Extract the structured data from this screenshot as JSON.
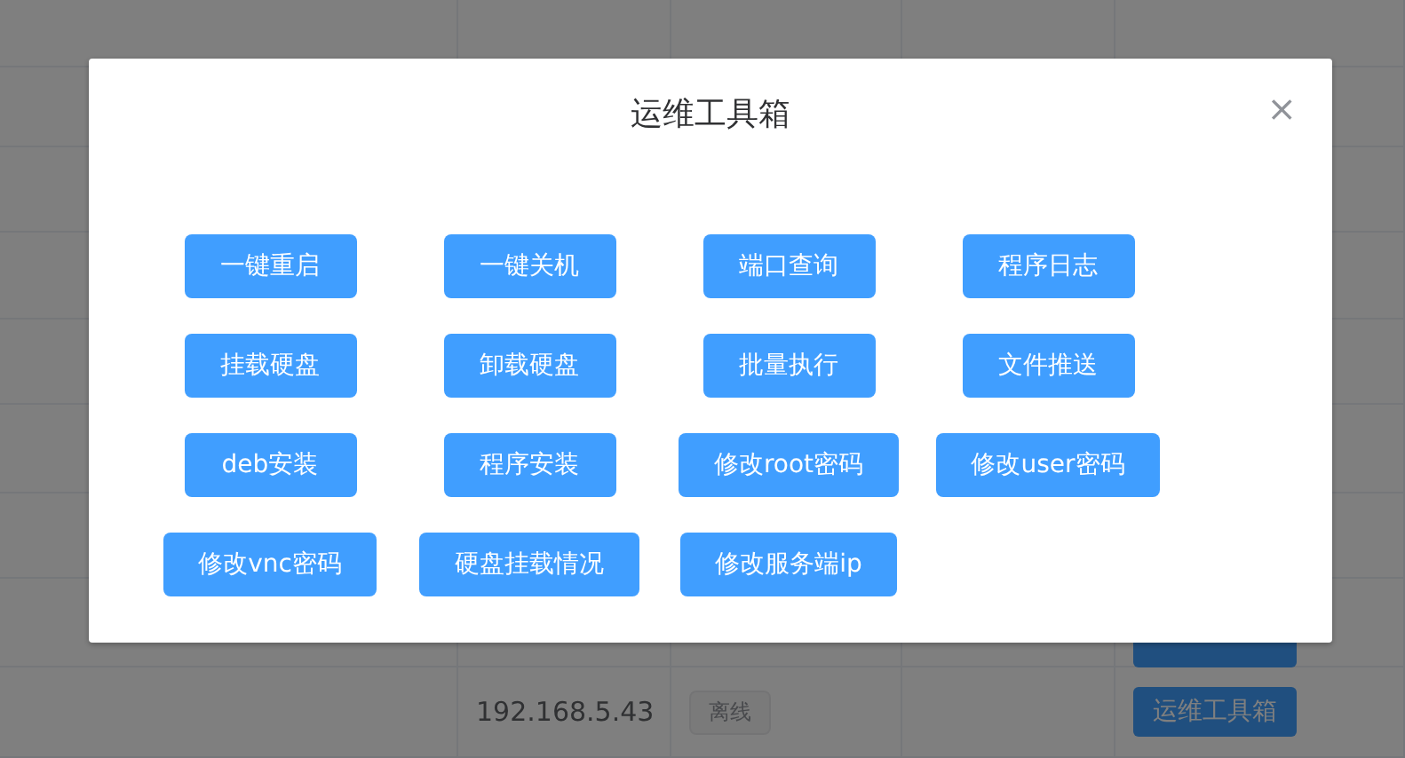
{
  "table": {
    "rows": [
      {
        "ip": "192.168.5.43",
        "status": "离线",
        "action": "运维工具箱"
      }
    ]
  },
  "dialog": {
    "title": "运维工具箱",
    "close": "×",
    "buttons": [
      "一键重启",
      "一键关机",
      "端口查询",
      "程序日志",
      "挂载硬盘",
      "卸载硬盘",
      "批量执行",
      "文件推送",
      "deb安装",
      "程序安装",
      "修改root密码",
      "修改user密码",
      "修改vnc密码",
      "硬盘挂载情况",
      "修改服务端ip"
    ]
  }
}
